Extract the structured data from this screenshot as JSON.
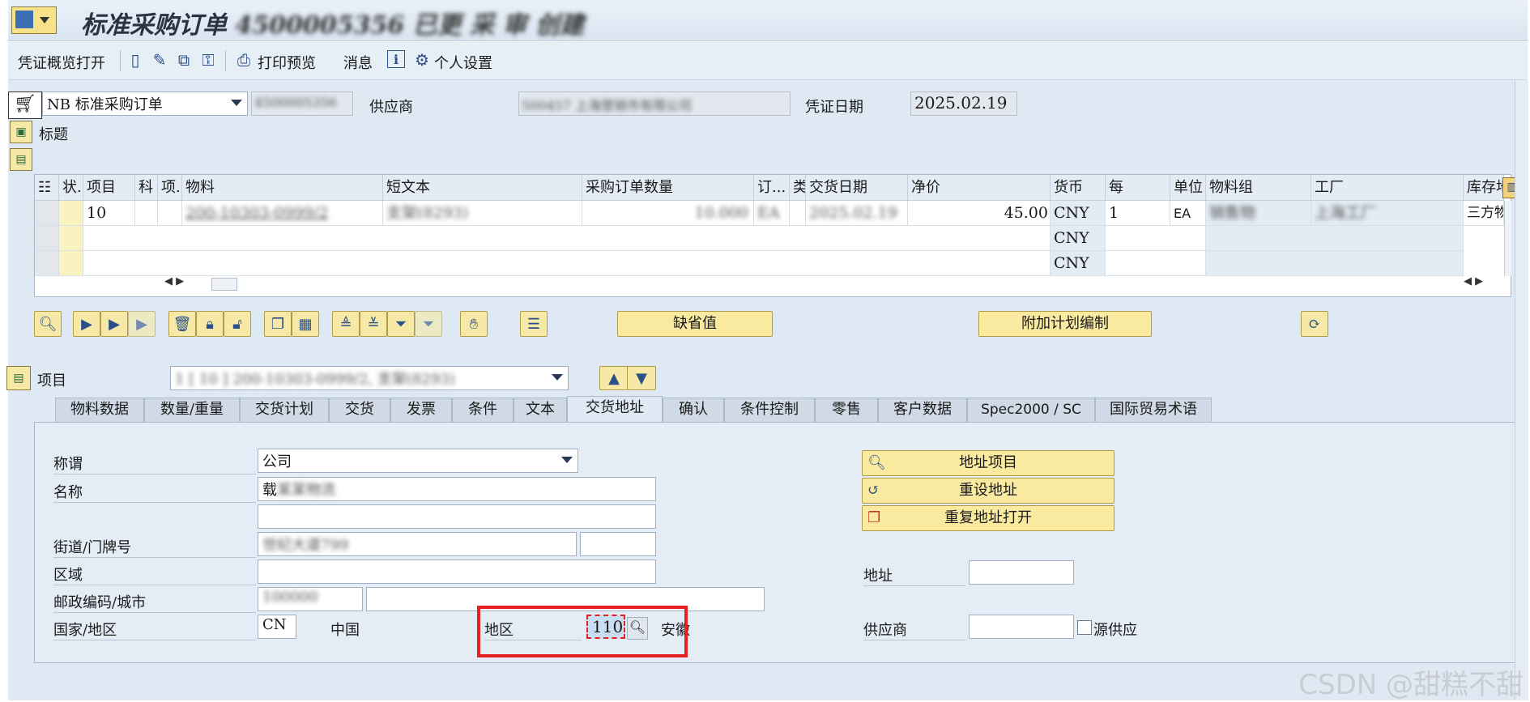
{
  "titlebar": {
    "title_main": "标准采购订单",
    "title_blurred": "4500005356 已更 采 审 创建"
  },
  "toolbar": {
    "items": [
      "凭证概览打开",
      "打印预览",
      "消息",
      "个人设置"
    ]
  },
  "header": {
    "doc_type": "NB 标准采购订单",
    "doc_number_blurred": "4500005356",
    "vendor_label": "供应商",
    "vendor_value_blurred": "500457 上海营销市有限公司",
    "doc_date_label": "凭证日期",
    "doc_date_value": "2025.02.19",
    "header_section_label": "标题"
  },
  "grid": {
    "columns": [
      "状.",
      "项目",
      "科",
      "项.",
      "物料",
      "短文本",
      "采购订单数量",
      "订...",
      "类",
      "交货日期",
      "净价",
      "货币",
      "每",
      "单位",
      "物料组",
      "工厂",
      "库存地"
    ],
    "rows": [
      {
        "item": "10",
        "material": "200-10303-0999/2",
        "short_text": "支架(8293)",
        "qty": "10.000",
        "uom_short": "EA",
        "date": "2025.02.19",
        "price": "45.00",
        "currency": "CNY",
        "per": "1",
        "unit": "EA",
        "matgroup": "销售物",
        "plant": "上海工厂",
        "storage": "三方物"
      },
      {
        "currency": "CNY"
      },
      {
        "currency": "CNY"
      }
    ]
  },
  "buttons": {
    "default_values": "缺省值",
    "additional_planning": "附加计划编制"
  },
  "item_selector": {
    "label": "项目",
    "value_blurred": "1 [ 10 ] 200-10303-0999/2, 支架(8293)"
  },
  "tabs": [
    "物料数据",
    "数量/重量",
    "交货计划",
    "交货",
    "发票",
    "条件",
    "文本",
    "交货地址",
    "确认",
    "条件控制",
    "零售",
    "客户数据",
    "Spec2000 / SC",
    "国际贸易术语"
  ],
  "address": {
    "title_label": "称谓",
    "title_value": "公司",
    "name_label": "名称",
    "name_value": "载",
    "name_value_blurred": "某某物流",
    "street_label": "街道/门牌号",
    "street_value_blurred": "世纪大道799",
    "district_label": "区域",
    "postal_label": "邮政编码/城市",
    "postal_value_blurred": "100000",
    "country_label": "国家/地区",
    "country_value": "CN",
    "country_name": "中国",
    "region_label": "地区",
    "region_value": "110",
    "region_name": "安徽",
    "btn_address_item": "地址项目",
    "btn_reset_address": "重设地址",
    "btn_duplicate_address": "重复地址打开",
    "address_label": "地址",
    "vendor_label": "供应商",
    "source_vendor_label": "源供应"
  },
  "watermark": "CSDN @甜糕不甜",
  "colors": {
    "highlight": "#e5201f",
    "button_yellow": "#f9eaa0"
  }
}
